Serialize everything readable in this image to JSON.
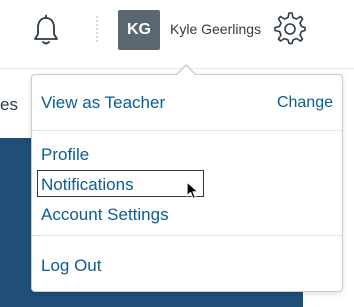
{
  "header": {
    "notifications_icon": "bell-icon",
    "settings_icon": "gear-icon",
    "user": {
      "initials": "KG",
      "name": "Kyle Geerlings"
    }
  },
  "background": {
    "partial_text": "es"
  },
  "menu": {
    "view_as": "View as Teacher",
    "change": "Change",
    "items": [
      {
        "label": "Profile"
      },
      {
        "label": "Notifications"
      },
      {
        "label": "Account Settings"
      }
    ],
    "logout": "Log Out"
  },
  "colors": {
    "link": "#0b5c8f",
    "avatar_bg": "#5b6770",
    "hero_bg": "#1f4e78",
    "text": "#2d3b45"
  }
}
